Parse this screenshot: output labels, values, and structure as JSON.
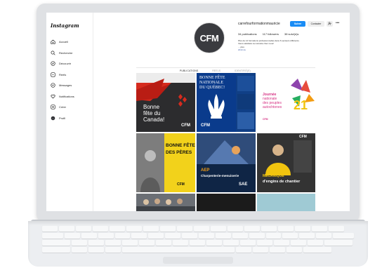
{
  "app": {
    "logo": "Instagram"
  },
  "sidebar": {
    "items": [
      {
        "label": "Accueil",
        "icon": "home-icon"
      },
      {
        "label": "Recherche",
        "icon": "search-icon"
      },
      {
        "label": "Découvrir",
        "icon": "compass-icon"
      },
      {
        "label": "Reels",
        "icon": "reels-icon"
      },
      {
        "label": "Messages",
        "icon": "message-icon"
      },
      {
        "label": "Notifications",
        "icon": "heart-icon"
      },
      {
        "label": "Créer",
        "icon": "plus-square-icon"
      },
      {
        "label": "Profil",
        "icon": "avatar-icon"
      }
    ]
  },
  "profile": {
    "avatar_text": "CFM",
    "username": "carrefourformationmauricie",
    "follow_label": "Suivre",
    "contact_label": "Contacter",
    "stats": {
      "posts": "34 publications",
      "followers": "117 followers",
      "following": "38 suivi(e)s"
    },
    "bio": [
      "Plus de 14 formations professionnelles dans 6 secteurs différents.",
      "Viens satisfaire ta curiosité chez nous!",
      "... plus"
    ],
    "link": "cfmtr.ca"
  },
  "tabs": [
    {
      "label": "PUBLICATIONS",
      "active": true
    },
    {
      "label": "REELS",
      "active": false
    },
    {
      "label": "IDENTIFIÉ(E)",
      "active": false
    }
  ],
  "posts": {
    "canada": {
      "line1": "Bonne",
      "line2": "fête du",
      "line3": "Canada!",
      "badge": "CFM"
    },
    "quebec": {
      "line1": "BONNE FÊTE",
      "line2": "NATIONALE",
      "line3": "DU QUÉBEC!",
      "badge": "CFM"
    },
    "autochtones": {
      "line1": "Journée",
      "line2": "nationale",
      "line3": "des peuples",
      "line4": "autochtones",
      "number": "21",
      "badge": "CFM"
    },
    "peres": {
      "line1": "BONNE FÊTE",
      "line2": "DES PÈRES",
      "badge": "CFM"
    },
    "charpente": {
      "line1": "AEP",
      "line2": "Charpenterie-menuiserie",
      "badge": "SAE"
    },
    "mecanique": {
      "line1": "MÉCANIQUE",
      "line2": "d'engins de chantier",
      "badge": "CFM"
    }
  },
  "colors": {
    "follow_blue": "#1a8cf5",
    "canada_red": "#d52b1e",
    "quebec_blue": "#0a3b8c",
    "peres_yellow": "#f2d21b",
    "sidebar_text": "#222222"
  }
}
